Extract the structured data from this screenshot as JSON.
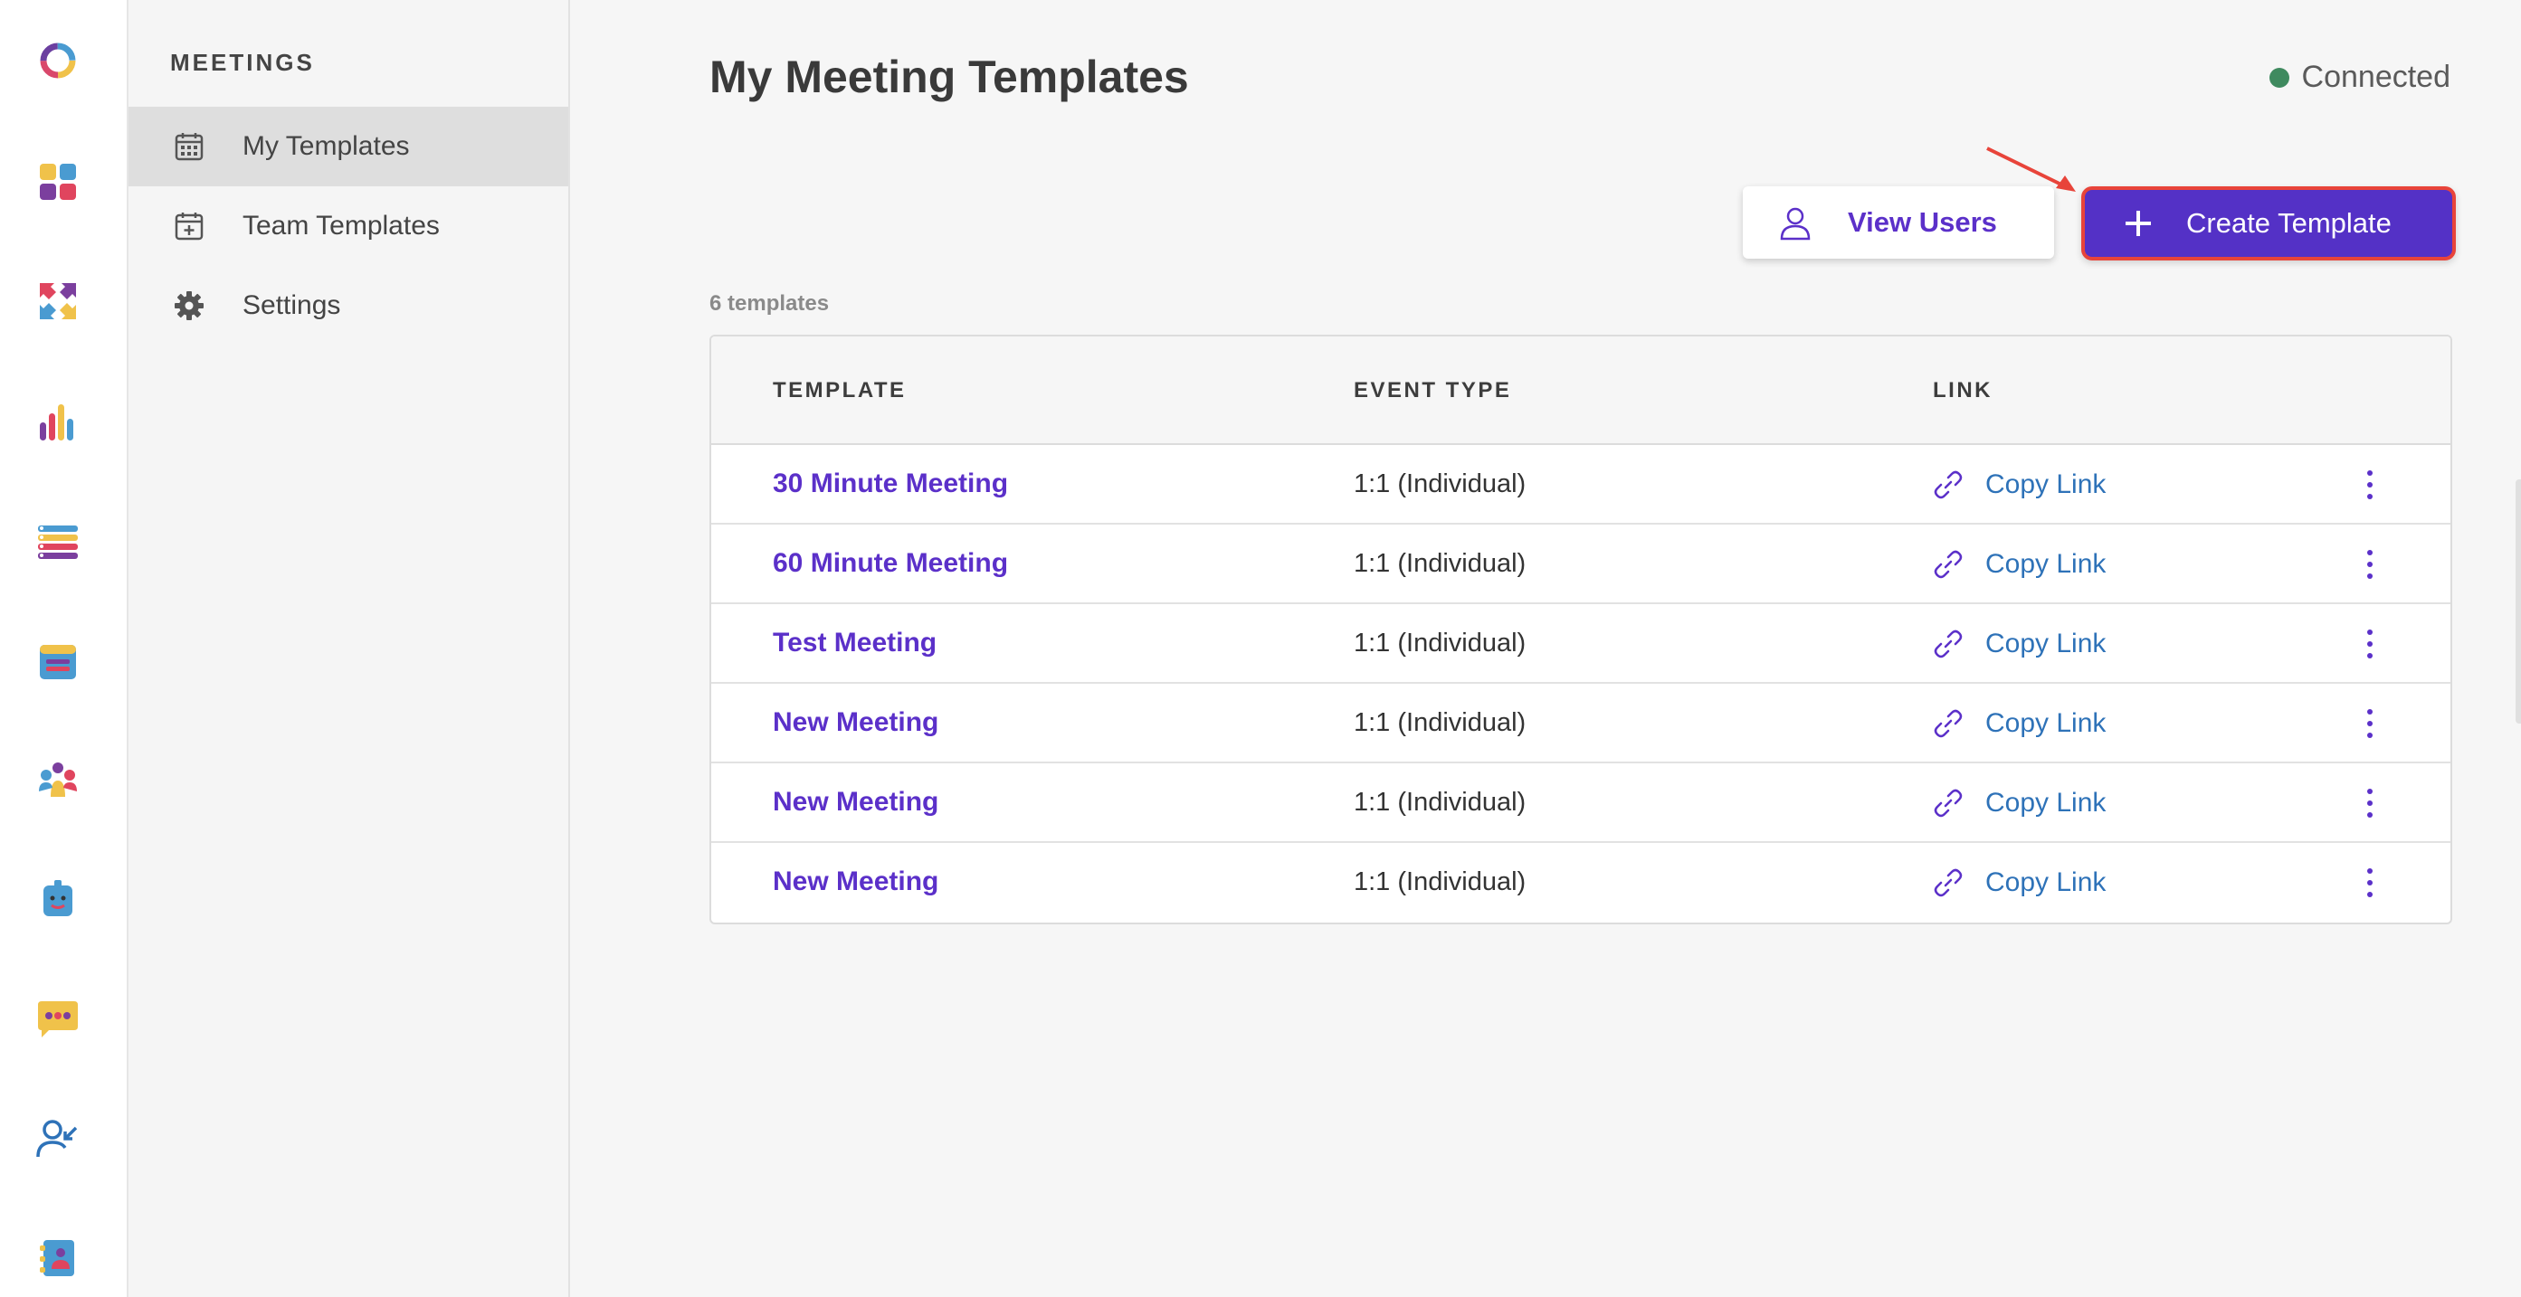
{
  "rail": {
    "icons": [
      "app-logo-icon",
      "dashboard-icon",
      "workflows-icon",
      "reports-icon",
      "lists-icon",
      "meetings-icon",
      "team-icon",
      "bot-icon",
      "chat-icon",
      "contact-import-icon",
      "directory-icon"
    ]
  },
  "sidebar": {
    "header": "MEETINGS",
    "items": [
      {
        "label": "My Templates",
        "icon": "calendar-icon",
        "active": true
      },
      {
        "label": "Team Templates",
        "icon": "calendar-plus-icon",
        "active": false
      },
      {
        "label": "Settings",
        "icon": "gear-icon",
        "active": false
      }
    ]
  },
  "header": {
    "title": "My Meeting Templates",
    "status": "Connected",
    "status_color": "#3f8a5f"
  },
  "toolbar": {
    "view_users_label": "View Users",
    "create_template_label": "Create Template",
    "accent": "#5431c6",
    "highlight": "#e8443a"
  },
  "table": {
    "count_label": "6 templates",
    "columns": [
      "TEMPLATE",
      "EVENT TYPE",
      "LINK"
    ],
    "rows": [
      {
        "name": "30 Minute Meeting",
        "event_type": "1:1 (Individual)",
        "link": "Copy Link"
      },
      {
        "name": "60 Minute Meeting",
        "event_type": "1:1 (Individual)",
        "link": "Copy Link"
      },
      {
        "name": "Test Meeting",
        "event_type": "1:1 (Individual)",
        "link": "Copy Link"
      },
      {
        "name": "New Meeting",
        "event_type": "1:1 (Individual)",
        "link": "Copy Link"
      },
      {
        "name": "New Meeting",
        "event_type": "1:1 (Individual)",
        "link": "Copy Link"
      },
      {
        "name": "New Meeting",
        "event_type": "1:1 (Individual)",
        "link": "Copy Link"
      }
    ]
  }
}
